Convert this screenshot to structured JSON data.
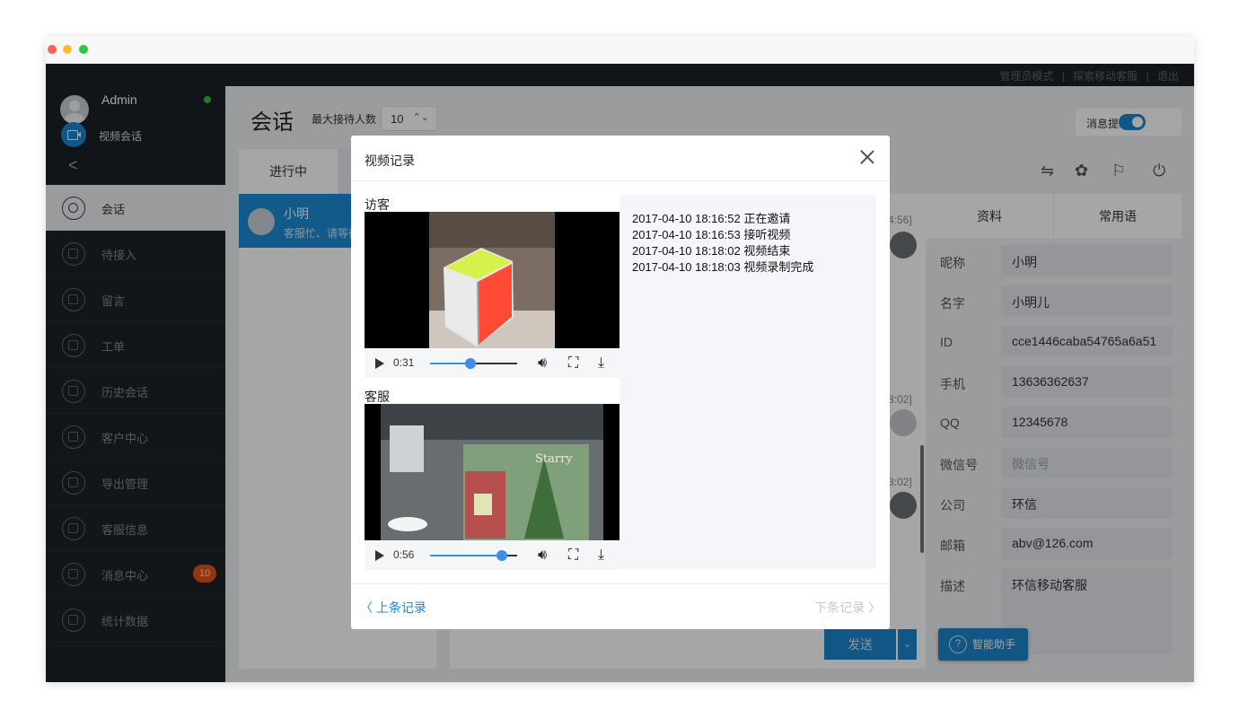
{
  "topbar": {
    "links": [
      "管理员模式",
      "探索移动客服",
      "退出"
    ],
    "separator": "|"
  },
  "user": {
    "name": "Admin",
    "video_label": "视频会话",
    "collapse": "<"
  },
  "nav": [
    {
      "label": "会话",
      "icon": "chat-bubble-icon"
    },
    {
      "label": "待接入",
      "icon": "hourglass-icon"
    },
    {
      "label": "留言",
      "icon": "note-edit-icon"
    },
    {
      "label": "工单",
      "icon": "document-icon"
    },
    {
      "label": "历史会话",
      "icon": "history-icon"
    },
    {
      "label": "客户中心",
      "icon": "customer-icon"
    },
    {
      "label": "导出管理",
      "icon": "download-icon"
    },
    {
      "label": "客服信息",
      "icon": "gear-icon"
    },
    {
      "label": "消息中心",
      "icon": "bell-icon",
      "badge": "10"
    },
    {
      "label": "统计数据",
      "icon": "chart-icon"
    }
  ],
  "header": {
    "title": "会话",
    "max_label": "最大接待人数",
    "max_value": "10",
    "sound_label": "消息提示音"
  },
  "conversations": {
    "tab": "进行中",
    "items": [
      {
        "name": "小明",
        "message": "客服忙、请等待..."
      }
    ]
  },
  "chat": {
    "timestamps": [
      "4:56]",
      "8:02]",
      "8:02]"
    ],
    "send_label": "发送",
    "dropdown": "⌄"
  },
  "info": {
    "tabs": [
      "资料",
      "常用语"
    ],
    "fields": [
      {
        "label": "昵称",
        "value": "小明"
      },
      {
        "label": "名字",
        "value": "小明儿"
      },
      {
        "label": "ID",
        "value": "cce1446caba54765a6a51"
      },
      {
        "label": "手机",
        "value": "13636362637"
      },
      {
        "label": "QQ",
        "value": "12345678"
      },
      {
        "label": "微信号",
        "value": "微信号",
        "placeholder": true
      },
      {
        "label": "公司",
        "value": "环信"
      },
      {
        "label": "邮箱",
        "value": "abv@126.com"
      },
      {
        "label": "描述",
        "value": "环信移动客服"
      }
    ],
    "assistant_label": "智能助手"
  },
  "modal": {
    "title": "视频记录",
    "visitor_label": "访客",
    "agent_label": "客服",
    "visitor_video": {
      "time": "0:31",
      "progress": 0.46
    },
    "agent_video": {
      "time": "0:56",
      "progress": 0.82
    },
    "log": [
      "2017-04-10 18:16:52 正在邀请",
      "2017-04-10 18:16:53 接听视频",
      "2017-04-10 18:18:02 视频结束",
      "2017-04-10 18:18:03 视频录制完成"
    ],
    "prev_label": "上条记录",
    "next_label": "下条记录"
  },
  "colors": {
    "accent": "#1c8ad3",
    "sidebar": "#1d2229",
    "badge": "#e25413",
    "online": "#31c13c"
  }
}
